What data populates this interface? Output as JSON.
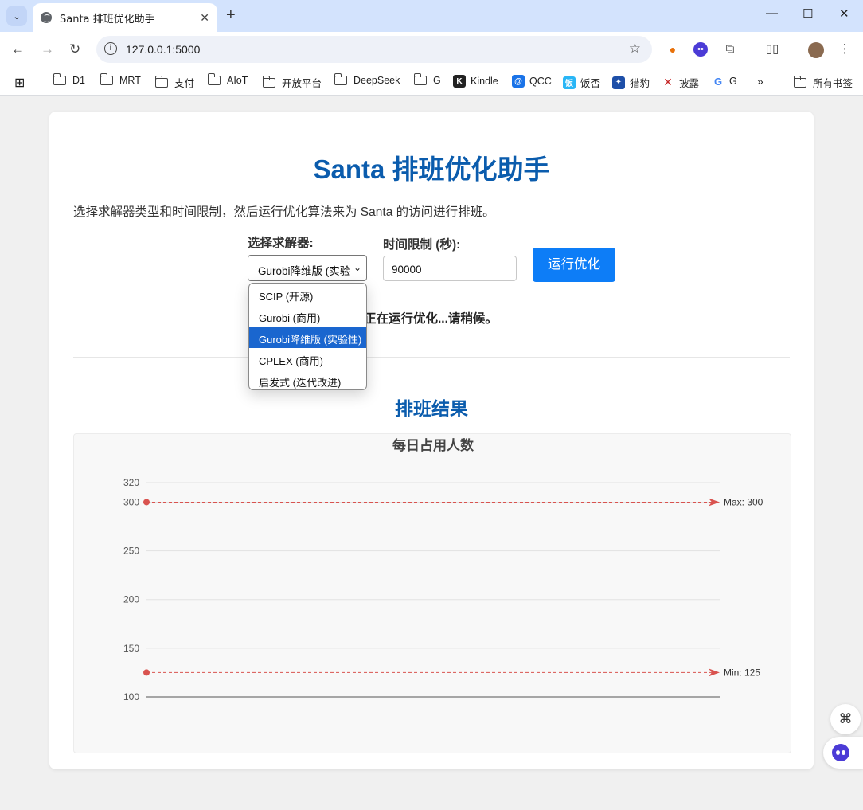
{
  "browser": {
    "tab_title": "Santa 排班优化助手",
    "url": "127.0.0.1:5000",
    "bookmarks": [
      "D1",
      "MRT",
      "支付",
      "AIoT",
      "开放平台",
      "DeepSeek",
      "G",
      "Kindle",
      "QCC",
      "饭否",
      "猎豹",
      "披露",
      "G"
    ],
    "all_bookmarks": "所有书签",
    "more": "»"
  },
  "page": {
    "title": "Santa 排班优化助手",
    "intro": "选择求解器类型和时间限制，然后运行优化算法来为 Santa 的访问进行排班。",
    "solver_label": "选择求解器:",
    "solver_value": "Gurobi降维版 (实验",
    "time_label": "时间限制 (秒):",
    "time_value": "90000",
    "run_button": "运行优化",
    "status": "正在运行优化...请稍候。",
    "result_title": "排班结果",
    "solver_options": [
      "SCIP (开源)",
      "Gurobi (商用)",
      "Gurobi降维版 (实验性)",
      "CPLEX (商用)",
      "启发式 (迭代改进)"
    ],
    "solver_selected_index": 2
  },
  "chart_data": {
    "type": "line",
    "title": "每日占用人数",
    "ylim": [
      100,
      320
    ],
    "yticks": [
      100,
      150,
      200,
      250,
      300,
      320
    ],
    "series": [
      {
        "name": "Max",
        "label": "Max: 300",
        "values": [
          300
        ],
        "color": "#d9534f",
        "style": "dashed"
      },
      {
        "name": "Min",
        "label": "Min: 125",
        "values": [
          125
        ],
        "color": "#d9534f",
        "style": "dashed"
      }
    ],
    "grid": true
  },
  "colors": {
    "accent": "#0b5cad",
    "button": "#0d7df7",
    "limit_line": "#d9534f"
  }
}
